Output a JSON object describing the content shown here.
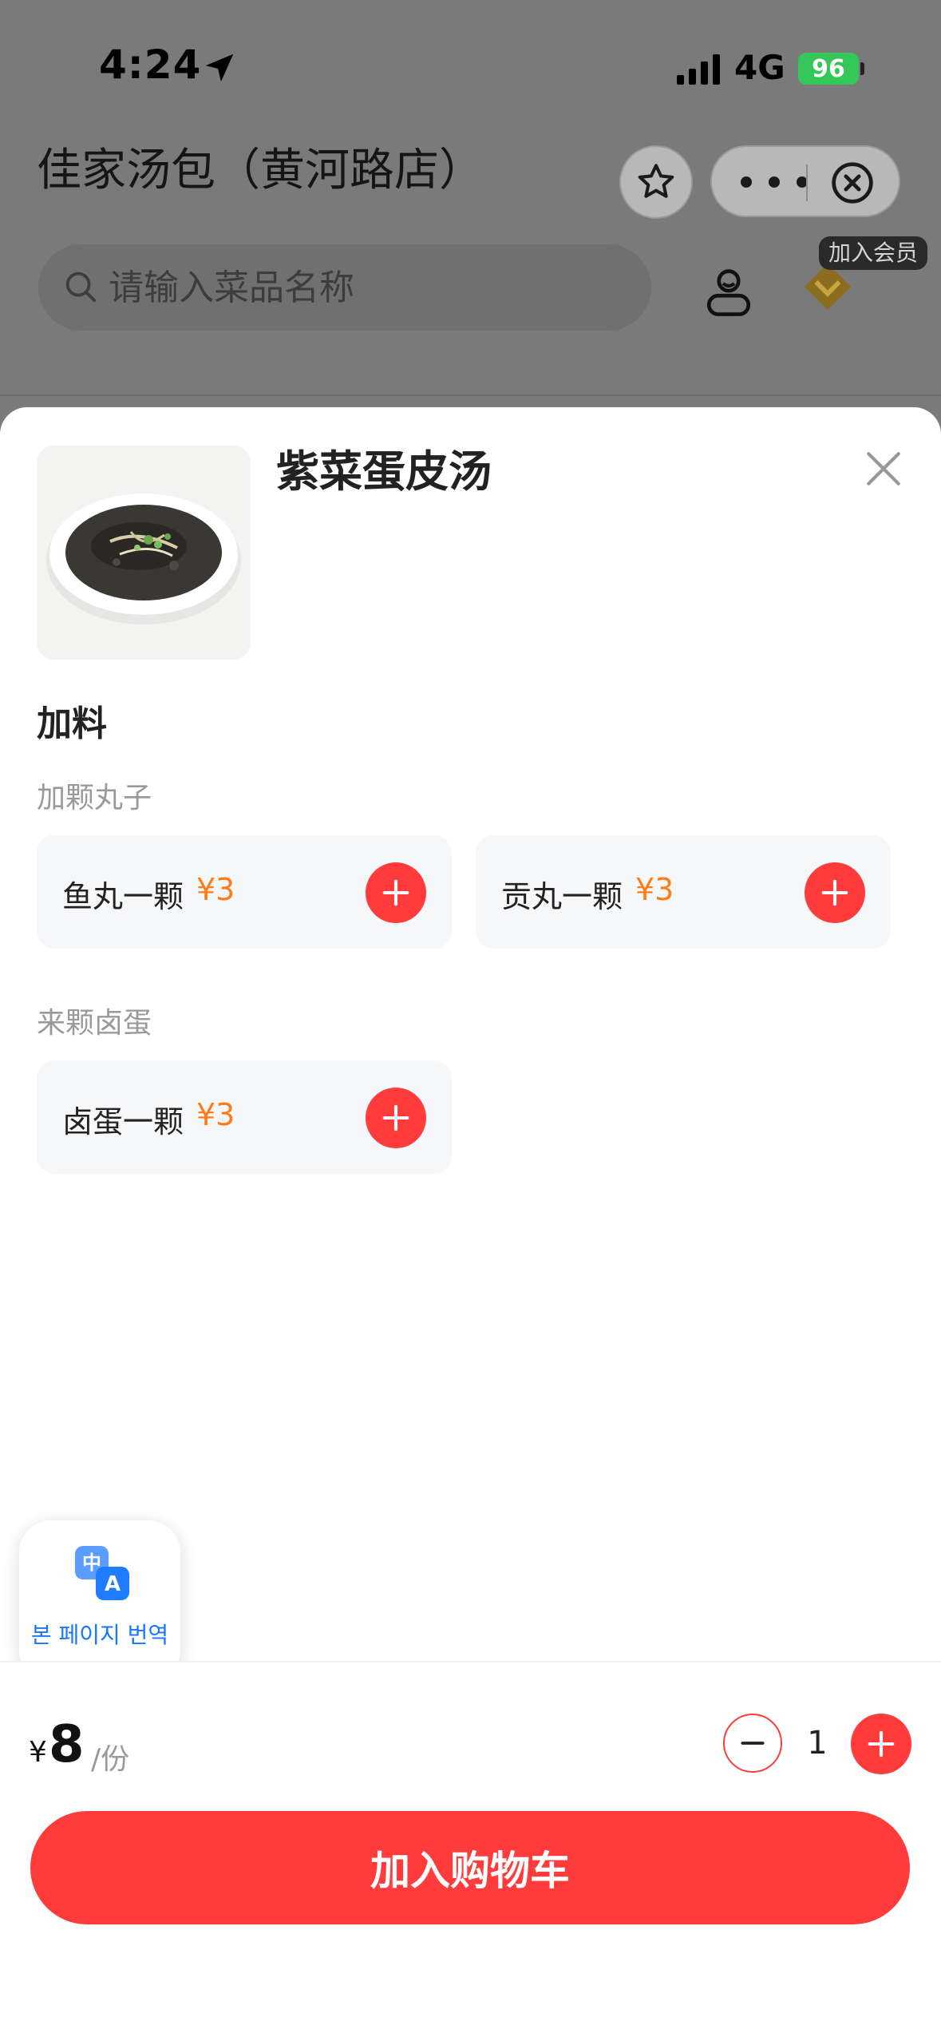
{
  "status_bar": {
    "time": "4:24",
    "network": "4G",
    "battery": "96"
  },
  "header": {
    "store_title": "佳家汤包（黄河路店）"
  },
  "search": {
    "placeholder": "请输入菜品名称"
  },
  "member": {
    "tag": "加入会员"
  },
  "dish": {
    "name": "紫菜蛋皮汤"
  },
  "addons": {
    "section_title": "加料",
    "groups": [
      {
        "label": "加颗丸子",
        "options": [
          {
            "name": "鱼丸一颗",
            "price": "¥3"
          },
          {
            "name": "贡丸一颗",
            "price": "¥3"
          }
        ]
      },
      {
        "label": "来颗卤蛋",
        "options": [
          {
            "name": "卤蛋一颗",
            "price": "¥3"
          }
        ]
      }
    ]
  },
  "translate": {
    "icon_top": "中",
    "icon_bottom": "A",
    "label": "본 페이지 번역"
  },
  "order": {
    "currency": "¥",
    "price": "8",
    "unit": "/份",
    "quantity": "1",
    "add_to_cart": "加入购物车"
  },
  "colors": {
    "accent_red": "#ff3b3b",
    "price_orange": "#ff7a1a",
    "translate_blue": "#1677ff",
    "battery_green": "#35c759"
  }
}
